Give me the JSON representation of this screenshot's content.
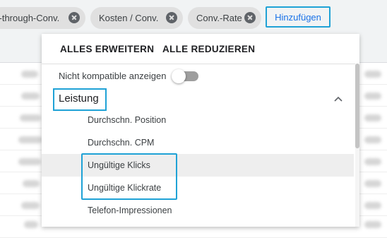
{
  "chips": [
    {
      "label": "v-through-Conv."
    },
    {
      "label": "Kosten / Conv."
    },
    {
      "label": "Conv.-Rate"
    }
  ],
  "add_label": "Hinzufügen",
  "panel": {
    "expand_all": "ALLES ERWEITERN",
    "collapse_all": "ALLE REDUZIEREN",
    "incompatible_label": "Nicht kompatible anzeigen",
    "incompatible_on": false,
    "section_title": "Leistung",
    "items": [
      {
        "label": "Durchschn. Position"
      },
      {
        "label": "Durchschn. CPM"
      },
      {
        "label": "Ungültige Klicks"
      },
      {
        "label": "Ungültige Klickrate"
      },
      {
        "label": "Telefon-Impressionen"
      }
    ]
  },
  "colors": {
    "highlight": "#1fa2d6",
    "accent": "#1a73e8"
  }
}
